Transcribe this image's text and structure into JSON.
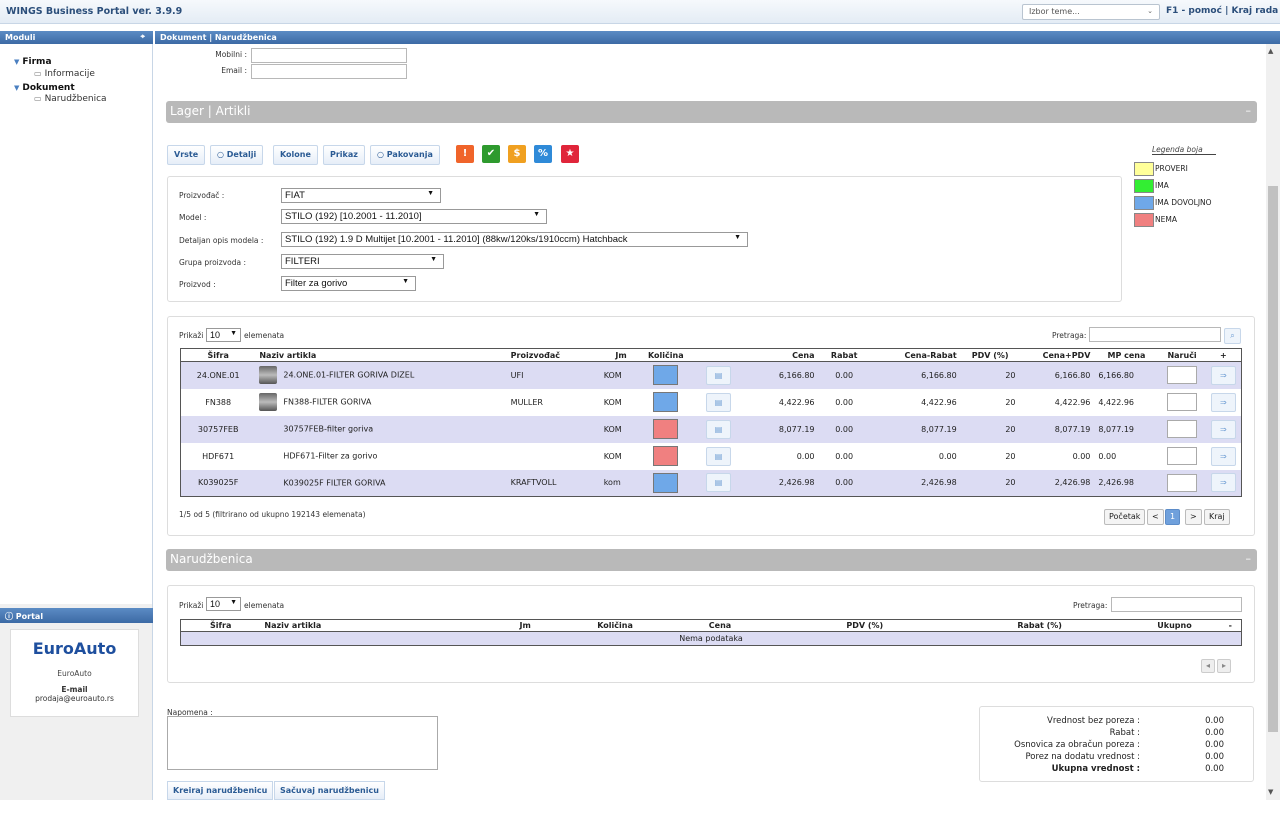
{
  "app": {
    "title": "WINGS Business Portal ver. 3.9.9",
    "theme_select": "Izbor teme...",
    "help": "F1 - pomoć | Kraj rada"
  },
  "sidebar": {
    "header": "Moduli",
    "tree": [
      {
        "label": "Firma",
        "children": [
          "Informacije"
        ]
      },
      {
        "label": "Dokument",
        "children": [
          "Narudžbenica"
        ]
      }
    ],
    "portal_header": "Portal",
    "portal_logo": "EuroAuto",
    "portal_name": "EuroAuto",
    "portal_email_label": "E-mail",
    "portal_email": "prodaja@euroauto.rs"
  },
  "main": {
    "breadcrumb": "Dokument | Narudžbenica",
    "contact": {
      "mobile_label": "Mobilni :",
      "email_label": "Email :"
    },
    "lager": {
      "title": "Lager | Artikli",
      "buttons": [
        "Vrste",
        "Detalji",
        "Kolone",
        "Prikaz",
        "Pakovanja"
      ],
      "icon_buttons": [
        {
          "icon": "alert-icon",
          "symbol": "!",
          "color": "#f0642a"
        },
        {
          "icon": "check-icon",
          "symbol": "✔",
          "color": "#2e9a2e"
        },
        {
          "icon": "dollar-icon",
          "symbol": "$",
          "color": "#f0a020"
        },
        {
          "icon": "percent-icon",
          "symbol": "%",
          "color": "#2f8ad8"
        },
        {
          "icon": "star-icon",
          "symbol": "★",
          "color": "#e0253a"
        }
      ],
      "legend": {
        "title": "Legenda boja",
        "items": [
          {
            "label": "PROVERI",
            "color": "#ffff99"
          },
          {
            "label": "IMA",
            "color": "#33ee33"
          },
          {
            "label": "IMA DOVOLJNO",
            "color": "#6fa8e8"
          },
          {
            "label": "NEMA",
            "color": "#f08080"
          }
        ]
      },
      "filters": {
        "manufacturer_label": "Proizvođač :",
        "manufacturer": "FIAT",
        "model_label": "Model :",
        "model": "STILO (192) [10.2001 - 11.2010]",
        "detail_label": "Detaljan opis modela :",
        "detail": "STILO (192) 1.9 D Multijet [10.2001 - 11.2010] (88kw/120ks/1910ccm) Hatchback",
        "group_label": "Grupa proizvoda :",
        "group": "FILTERI",
        "product_label": "Proizvod :",
        "product": "Filter za gorivo"
      },
      "show_label": "Prikaži",
      "show_count": "10",
      "show_suffix": "elemenata",
      "search_label": "Pretraga:",
      "columns": [
        "Šifra",
        "Naziv artikla",
        "Proizvođač",
        "Jm",
        "Količina",
        "",
        "Cena",
        "Rabat",
        "Cena-Rabat",
        "PDV (%)",
        "Cena+PDV",
        "MP cena",
        "Naruči",
        "+"
      ],
      "rows": [
        {
          "sifra": "24.ONE.01",
          "naziv": "24.ONE.01-FILTER GORIVA DIZEL",
          "proizvodjac": "UFI",
          "jm": "KOM",
          "stock_color": "#6fa8e8",
          "cena": "6,166.80",
          "rabat": "0.00",
          "cena_rabat": "6,166.80",
          "pdv": "20",
          "cena_pdv": "6,166.80",
          "mp": "6,166.80",
          "img": true
        },
        {
          "sifra": "FN388",
          "naziv": "FN388-FILTER GORIVA",
          "proizvodjac": "MULLER",
          "jm": "KOM",
          "stock_color": "#6fa8e8",
          "cena": "4,422.96",
          "rabat": "0.00",
          "cena_rabat": "4,422.96",
          "pdv": "20",
          "cena_pdv": "4,422.96",
          "mp": "4,422.96",
          "img": true
        },
        {
          "sifra": "30757FEB",
          "naziv": "30757FEB-filter goriva",
          "proizvodjac": "",
          "jm": "KOM",
          "stock_color": "#f08080",
          "cena": "8,077.19",
          "rabat": "0.00",
          "cena_rabat": "8,077.19",
          "pdv": "20",
          "cena_pdv": "8,077.19",
          "mp": "8,077.19",
          "img": false
        },
        {
          "sifra": "HDF671",
          "naziv": "HDF671-Filter za gorivo",
          "proizvodjac": "",
          "jm": "KOM",
          "stock_color": "#f08080",
          "cena": "0.00",
          "rabat": "0.00",
          "cena_rabat": "0.00",
          "pdv": "20",
          "cena_pdv": "0.00",
          "mp": "0.00",
          "img": false
        },
        {
          "sifra": "K039025F",
          "naziv": "K039025F FILTER GORIVA",
          "proizvodjac": "KRAFTVOLL",
          "jm": "kom",
          "stock_color": "#6fa8e8",
          "cena": "2,426.98",
          "rabat": "0.00",
          "cena_rabat": "2,426.98",
          "pdv": "20",
          "cena_pdv": "2,426.98",
          "mp": "2,426.98",
          "img": false
        }
      ],
      "info": "1/5 od 5 (filtrirano od ukupno 192143 elemenata)",
      "pager": {
        "first": "Početak",
        "prev": "<",
        "page": "1",
        "next": ">",
        "last": "Kraj"
      }
    },
    "order": {
      "title": "Narudžbenica",
      "show_label": "Prikaži",
      "show_count": "10",
      "show_suffix": "elemenata",
      "search_label": "Pretraga:",
      "columns": [
        "Šifra",
        "Naziv artikla",
        "Jm",
        "Količina",
        "Cena",
        "PDV (%)",
        "Rabat (%)",
        "Ukupno",
        "-"
      ],
      "empty": "Nema podataka"
    },
    "note_label": "Napomena :",
    "totals": [
      {
        "label": "Vrednost bez poreza :",
        "value": "0.00"
      },
      {
        "label": "Rabat :",
        "value": "0.00"
      },
      {
        "label": "Osnovica za obračun poreza :",
        "value": "0.00"
      },
      {
        "label": "Porez na dodatu vrednost :",
        "value": "0.00"
      },
      {
        "label": "Ukupna vrednost :",
        "value": "0.00",
        "bold": true
      }
    ],
    "actions": {
      "create": "Kreiraj narudžbenicu",
      "save": "Sačuvaj narudžbenicu"
    }
  }
}
